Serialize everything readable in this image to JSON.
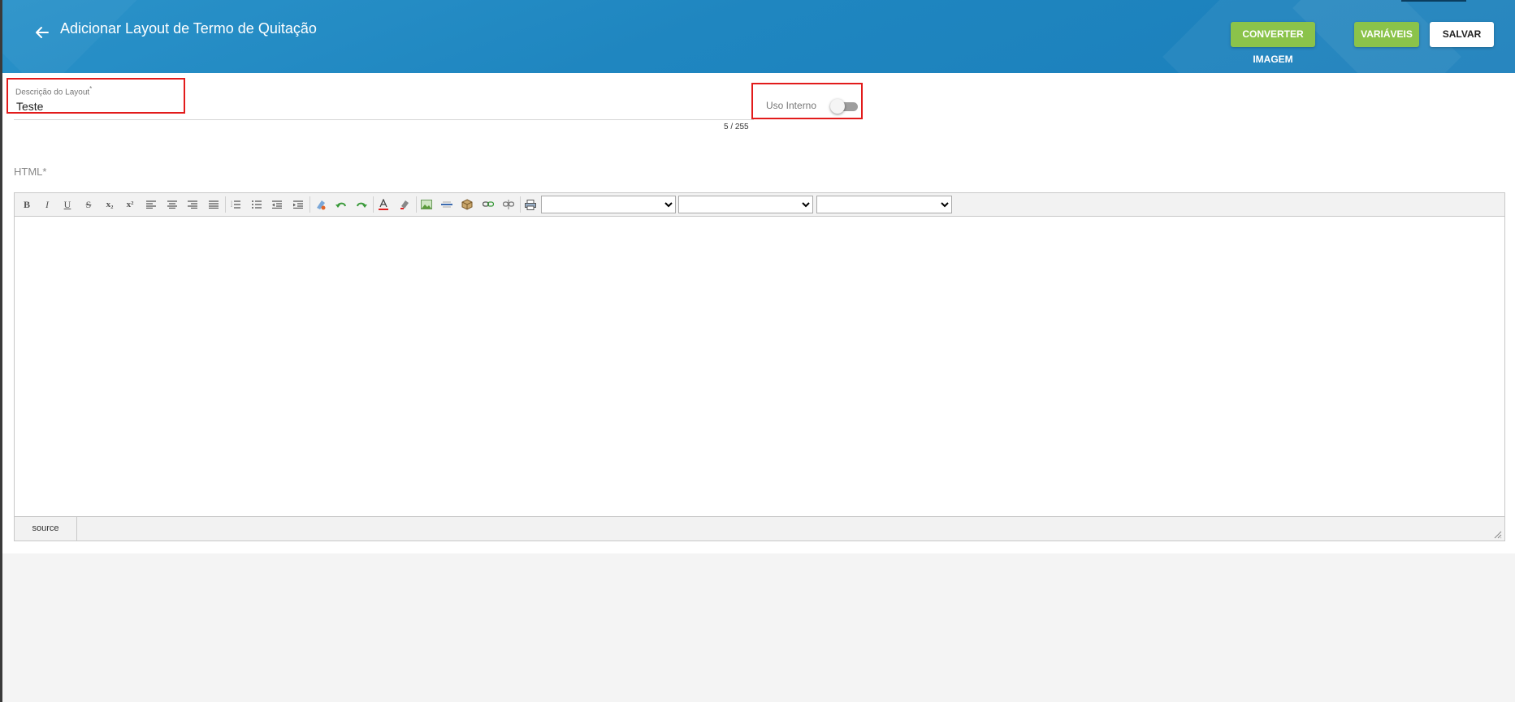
{
  "header": {
    "title": "Adicionar Layout de Termo de Quitação",
    "buttons": {
      "convert": "CONVERTER IMAGEM",
      "variables": "VARIÁVEIS",
      "save": "SALVAR"
    }
  },
  "form": {
    "description_label": "Descrição do Layout",
    "required_mark": "*",
    "description_value": "Teste",
    "counter": "5 / 255",
    "internal_use_label": "Uso Interno",
    "internal_use_enabled": false
  },
  "editor": {
    "label": "HTML*",
    "toolbar": {
      "bold": "B",
      "italic": "I",
      "underline": "U",
      "strike": "S",
      "subscript": "x₂",
      "superscript": "x²",
      "font_select": "",
      "size_select": "",
      "format_select": ""
    },
    "content": "",
    "source_tab": "source"
  },
  "colors": {
    "header": "#1f86c0",
    "green_button": "#8bc34a",
    "highlight": "#e21b1b"
  }
}
